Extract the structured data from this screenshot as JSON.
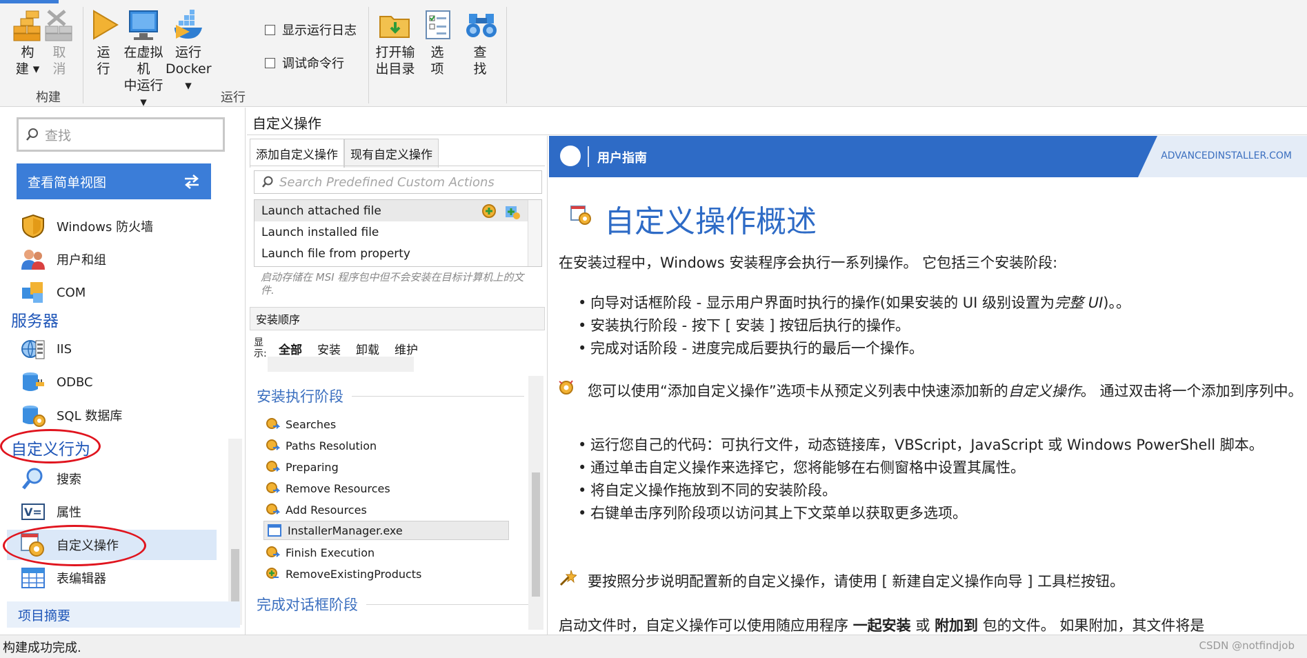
{
  "ribbon": {
    "build_group": {
      "label": "构建",
      "build_line1": "构",
      "build_line2": "建 ▾",
      "cancel_line1": "取",
      "cancel_line2": "消"
    },
    "run_group": {
      "label": "运行",
      "run_line1": "运",
      "run_line2": "行",
      "vm_line1": "在虚拟机",
      "vm_line2": "中运行 ▾",
      "docker_line1": "运行",
      "docker_line2": "Docker ▾",
      "show_log": "显示运行日志",
      "debug_cmd": "调试命令行"
    },
    "open_output_line1": "打开输",
    "open_output_line2": "出目录",
    "options_line1": "选",
    "options_line2": "项",
    "find_line1": "查",
    "find_line2": "找"
  },
  "sidebar": {
    "search_placeholder": "查找",
    "simple_view": "查看简单视图",
    "items_top": [
      {
        "label": "Windows 防火墙",
        "icon": "shield-icon"
      },
      {
        "label": "用户和组",
        "icon": "users-icon"
      },
      {
        "label": "COM",
        "icon": "com-icon"
      }
    ],
    "server_header": "服务器",
    "server_items": [
      {
        "label": "IIS",
        "icon": "iis-icon"
      },
      {
        "label": "ODBC",
        "icon": "odbc-icon"
      },
      {
        "label": "SQL 数据库",
        "icon": "sql-database-icon"
      }
    ],
    "custom_header": "自定义行为",
    "custom_items": [
      {
        "label": "搜索",
        "icon": "search-icon"
      },
      {
        "label": "属性",
        "icon": "properties-icon"
      },
      {
        "label": "自定义操作",
        "icon": "custom-action-icon"
      },
      {
        "label": "表编辑器",
        "icon": "table-editor-icon"
      }
    ],
    "footer": "项目摘要"
  },
  "page_title": "自定义操作",
  "mid": {
    "tabs": [
      "添加自定义操作",
      "现有自定义操作"
    ],
    "search_placeholder": "Search Predefined Custom Actions",
    "actions": [
      "Launch attached file",
      "Launch installed file",
      "Launch file from property"
    ],
    "action_desc": "启动存储在 MSI 程序包中但不会安装在目标计算机上的文件.",
    "sequence_header": "安装顺序",
    "filter_label": "显示:",
    "filters": [
      "全部",
      "安装",
      "卸载",
      "维护"
    ],
    "phase1": "安装执行阶段",
    "steps": [
      "Searches",
      "Paths Resolution",
      "Preparing",
      "Remove Resources",
      "Add Resources",
      "InstallerManager.exe",
      "Finish Execution",
      "RemoveExistingProducts"
    ],
    "phase2": "完成对话框阶段"
  },
  "guide": {
    "header_label": "用户指南",
    "brand": "ADVANCEDINSTALLER.COM",
    "title": "自定义操作概述",
    "intro": "在安装过程中，Windows 安装程序会执行一系列操作。 它包括三个安装阶段:",
    "phases": [
      {
        "text": "向导对话框阶段 - 显示用户界面时执行的操作(如果安装的 UI 级别设置为",
        "em": "完整 UI",
        "tail": ")。。"
      },
      {
        "text": "安装执行阶段 - 按下 [ 安装 ] 按钮后执行的操作。",
        "em": "",
        "tail": ""
      },
      {
        "text": "完成对话阶段 - 进度完成后要执行的最后一个操作。",
        "em": "",
        "tail": ""
      }
    ],
    "tip1_a": "您可以使用“添加自定义操作”选项卡从预定义列表中快速添加新的",
    "tip1_em": "自定义操作",
    "tip1_b": "。 通过双击将一个添加到序列中。",
    "bullets": [
      "运行您自己的代码：可执行文件，动态链接库，VBScript，JavaScript 或 Windows PowerShell 脚本。",
      "通过单击自定义操作来选择它，您将能够在右侧窗格中设置其属性。",
      "将自定义操作拖放到不同的安装阶段。",
      "右键单击序列阶段项以访问其上下文菜单以获取更多选项。"
    ],
    "tip2": "要按照分步说明配置新的自定义操作，请使用 [ 新建自定义操作向导 ] 工具栏按钮。",
    "last_a": "启动文件时，自定义操作可以使用随应用程序",
    "last_b1": "一起安装",
    "last_mid": "或",
    "last_b2": "附加到",
    "last_c": "包的文件。 如果附加，其文件将是"
  },
  "status": "构建成功完成.",
  "watermark": "CSDN @notfindjob",
  "colors": {
    "accent": "#3b7dd8",
    "guide_header": "#2e6bc6",
    "annotation": "#e0141e"
  }
}
